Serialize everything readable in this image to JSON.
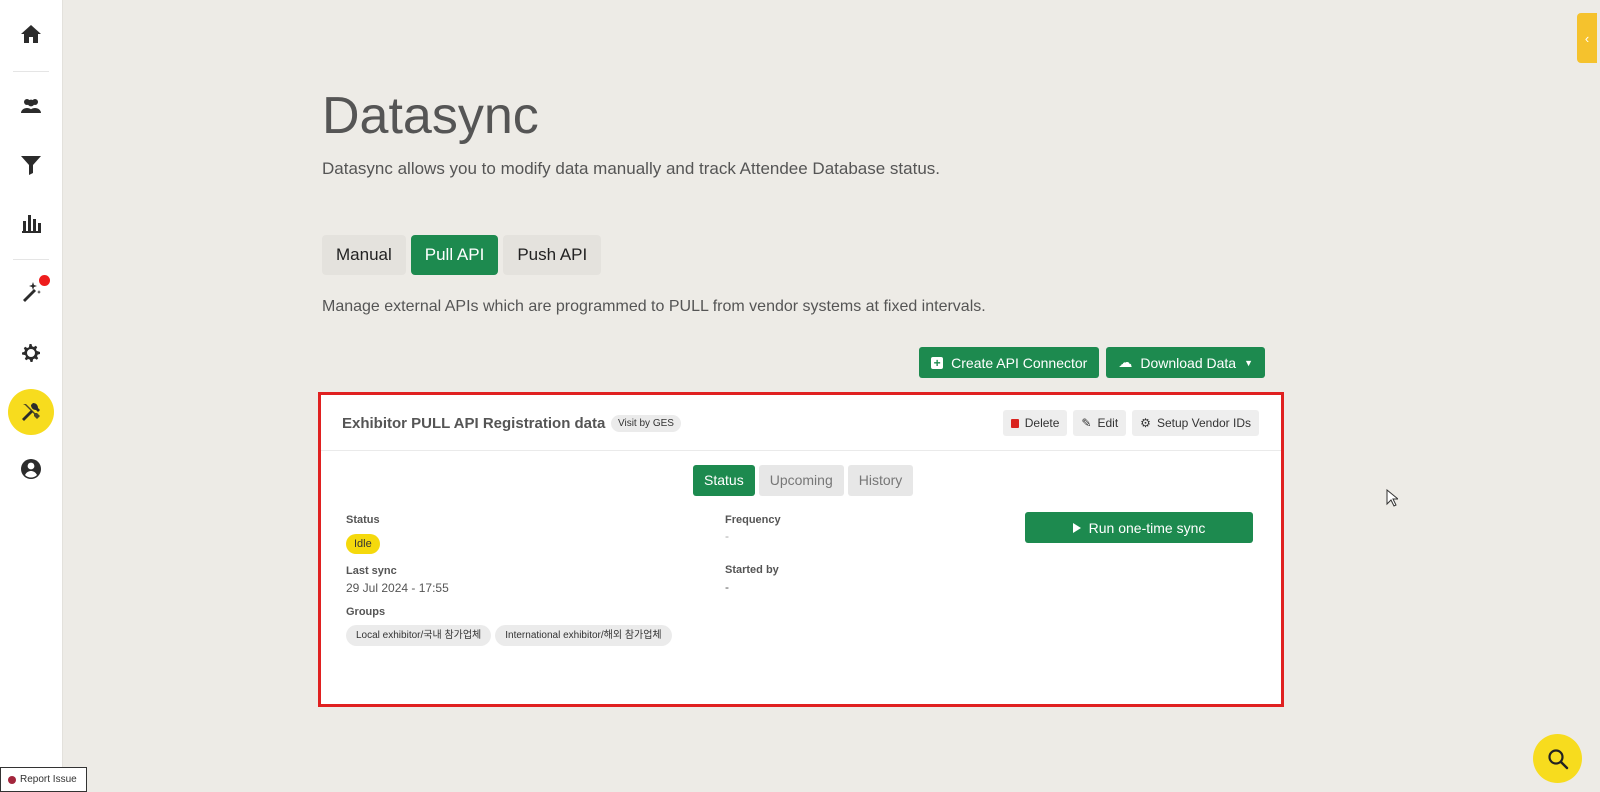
{
  "sidebar": {
    "items": [
      {
        "name": "home",
        "icon": "home-icon"
      },
      {
        "name": "attendees",
        "icon": "users-icon"
      },
      {
        "name": "filter",
        "icon": "filter-icon"
      },
      {
        "name": "analytics",
        "icon": "bar-chart-icon"
      },
      {
        "name": "magic",
        "icon": "magic-wand-icon"
      },
      {
        "name": "settings",
        "icon": "gear-icon"
      },
      {
        "name": "tools",
        "icon": "tools-icon"
      },
      {
        "name": "account",
        "icon": "user-circle-icon"
      }
    ]
  },
  "page": {
    "title": "Datasync",
    "subtitle": "Datasync allows you to modify data manually and track Attendee Database status."
  },
  "tabs": [
    "Manual",
    "Pull API",
    "Push API"
  ],
  "active_tab": "Pull API",
  "tab_description": "Manage external APIs which are programmed to PULL from vendor systems at fixed intervals.",
  "actions": {
    "create_label": "Create API Connector",
    "download_label": "Download Data"
  },
  "connector": {
    "title": "Exhibitor PULL API Registration data",
    "vendor_badge": "Visit by GES",
    "delete_label": "Delete",
    "edit_label": "Edit",
    "setup_label": "Setup Vendor IDs",
    "inner_tabs": [
      "Status",
      "Upcoming",
      "History"
    ],
    "status_label": "Status",
    "status_value": "Idle",
    "last_sync_label": "Last sync",
    "last_sync_value": "29 Jul 2024 - 17:55",
    "groups_label": "Groups",
    "groups": [
      "Local exhibitor/국내 참가업체",
      "International exhibitor/해외 참가업체"
    ],
    "frequency_label": "Frequency",
    "frequency_value": "-",
    "started_by_label": "Started by",
    "started_by_value": "-",
    "run_label": "Run one-time sync"
  },
  "footer": {
    "report_label": "Report Issue"
  },
  "colors": {
    "accent_green": "#1d8a4f",
    "accent_yellow": "#f7dc1e",
    "highlight_red": "#e02020"
  }
}
